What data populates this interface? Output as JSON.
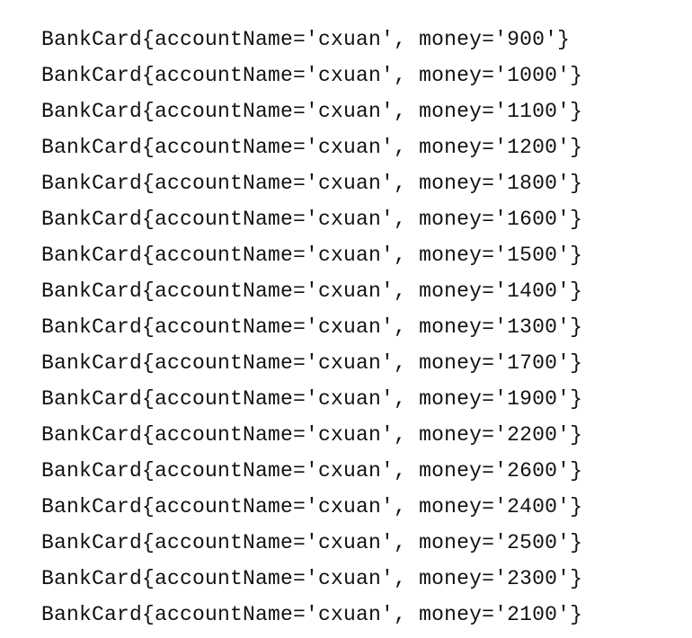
{
  "console": {
    "lines": [
      "BankCard{accountName='cxuan', money='900'}",
      "BankCard{accountName='cxuan', money='1000'}",
      "BankCard{accountName='cxuan', money='1100'}",
      "BankCard{accountName='cxuan', money='1200'}",
      "BankCard{accountName='cxuan', money='1800'}",
      "BankCard{accountName='cxuan', money='1600'}",
      "BankCard{accountName='cxuan', money='1500'}",
      "BankCard{accountName='cxuan', money='1400'}",
      "BankCard{accountName='cxuan', money='1300'}",
      "BankCard{accountName='cxuan', money='1700'}",
      "BankCard{accountName='cxuan', money='1900'}",
      "BankCard{accountName='cxuan', money='2200'}",
      "BankCard{accountName='cxuan', money='2600'}",
      "BankCard{accountName='cxuan', money='2400'}",
      "BankCard{accountName='cxuan', money='2500'}",
      "BankCard{accountName='cxuan', money='2300'}",
      "BankCard{accountName='cxuan', money='2100'}"
    ]
  }
}
